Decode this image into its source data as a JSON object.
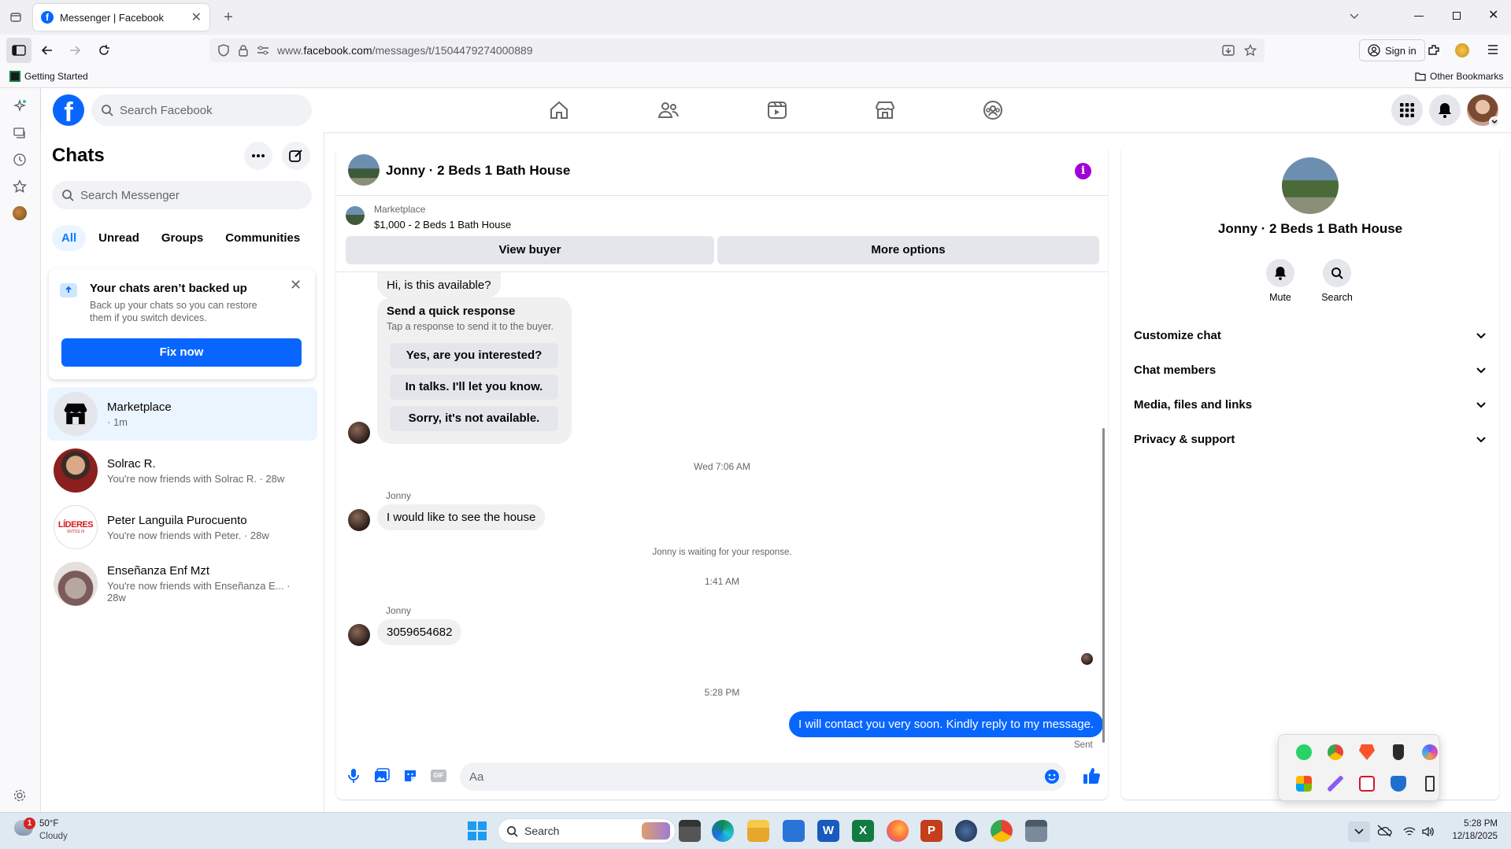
{
  "browser": {
    "tab_title": "Messenger | Facebook",
    "url_prefix": "www.",
    "url_domain": "facebook.com",
    "url_path": "/messages/t/1504479274000889",
    "sign_in": "Sign in",
    "bookmark_getting_started": "Getting Started",
    "other_bookmarks": "Other Bookmarks"
  },
  "fb": {
    "search_placeholder": "Search Facebook",
    "brand_color": "#0866ff"
  },
  "chats": {
    "title": "Chats",
    "search_placeholder": "Search Messenger",
    "filters": [
      "All",
      "Unread",
      "Groups",
      "Communities"
    ],
    "backup": {
      "title": "Your chats aren’t backed up",
      "body": "Back up your chats so you can restore them if you switch devices.",
      "button": "Fix now"
    },
    "items": [
      {
        "name": "Marketplace",
        "sub": "· 1m"
      },
      {
        "name": "Solrac R.",
        "sub": "You're now friends with Solrac R. · 28w"
      },
      {
        "name": "Peter Languila Purocuento",
        "sub": "You're now friends with Peter. · 28w",
        "avatar_text": "LÍDERES",
        "avatar_subtext": "SNTSS III"
      },
      {
        "name": "Enseñanza Enf Mzt",
        "sub": "You're now friends with Enseñanza E... · 28w"
      }
    ]
  },
  "conversation": {
    "header_title": "Jonny · 2 Beds 1 Bath House",
    "listing": {
      "source": "Marketplace",
      "title": "$1,000 - 2 Beds 1 Bath House"
    },
    "view_buyer": "View buyer",
    "more_options": "More options",
    "messages": {
      "first": "Hi, is this available?",
      "quick_title": "Send a quick response",
      "quick_sub": "Tap a response to send it to the buyer.",
      "quick_replies": [
        "Yes, are you interested?",
        "In talks. I'll let you know.",
        "Sorry, it's not available."
      ],
      "ts1": "Wed 7:06 AM",
      "sender1": "Jonny",
      "msg1": "I would like to see the house",
      "waiting": "Jonny is waiting for your response.",
      "ts2": "1:41 AM",
      "sender2": "Jonny",
      "msg2": "3059654682",
      "ts3": "5:28 PM",
      "my_msg": "I will contact you very soon. Kindly reply to my message.",
      "status": "Sent"
    },
    "composer_placeholder": "Aa"
  },
  "info": {
    "title": "Jonny · 2 Beds 1 Bath House",
    "mute": "Mute",
    "search": "Search",
    "sections": [
      "Customize chat",
      "Chat members",
      "Media, files and links",
      "Privacy & support"
    ]
  },
  "taskbar": {
    "weather_temp": "50°F",
    "weather_desc": "Cloudy",
    "weather_badge": "1",
    "search": "Search",
    "time": "5:28 PM",
    "date": "12/18/2025"
  }
}
